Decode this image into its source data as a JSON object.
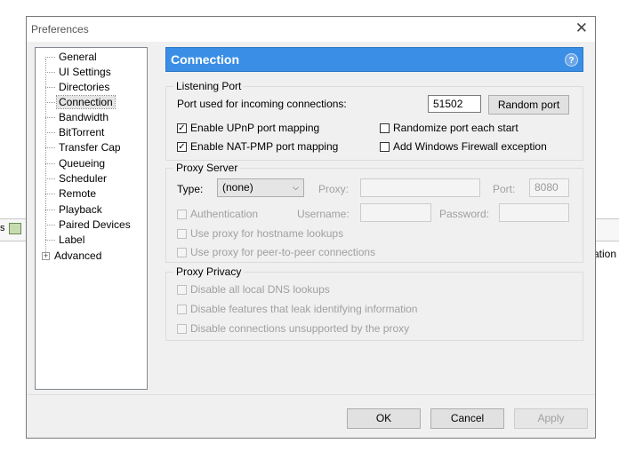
{
  "background": {
    "toolbar_text": "s",
    "right_text": "ation"
  },
  "dialog": {
    "title": "Preferences"
  },
  "tree": {
    "items": [
      {
        "label": "General"
      },
      {
        "label": "UI Settings"
      },
      {
        "label": "Directories"
      },
      {
        "label": "Connection",
        "selected": true
      },
      {
        "label": "Bandwidth"
      },
      {
        "label": "BitTorrent"
      },
      {
        "label": "Transfer Cap"
      },
      {
        "label": "Queueing"
      },
      {
        "label": "Scheduler"
      },
      {
        "label": "Remote"
      },
      {
        "label": "Playback"
      },
      {
        "label": "Paired Devices"
      },
      {
        "label": "Label"
      },
      {
        "label": "Advanced",
        "expandable": true,
        "expander": "+"
      }
    ]
  },
  "header": {
    "title": "Connection",
    "help": "?"
  },
  "listening_port": {
    "title": "Listening Port",
    "port_label": "Port used for incoming connections:",
    "port_value": "51502",
    "random_port_label": "Random port",
    "upnp_label": "Enable UPnP port mapping",
    "upnp_checked": true,
    "natpmp_label": "Enable NAT-PMP port mapping",
    "natpmp_checked": true,
    "randomize_label": "Randomize port each start",
    "randomize_checked": false,
    "firewall_label": "Add Windows Firewall exception",
    "firewall_checked": false,
    "check_mark": "✓"
  },
  "proxy_server": {
    "title": "Proxy Server",
    "type_label": "Type:",
    "type_value": "(none)",
    "proxy_label": "Proxy:",
    "proxy_value": "",
    "port_label": "Port:",
    "port_value": "8080",
    "auth_label": "Authentication",
    "username_label": "Username:",
    "username_value": "",
    "password_label": "Password:",
    "password_value": "",
    "hostname_label": "Use proxy for hostname lookups",
    "p2p_label": "Use proxy for peer-to-peer connections"
  },
  "proxy_privacy": {
    "title": "Proxy Privacy",
    "dns_label": "Disable all local DNS lookups",
    "leak_label": "Disable features that leak identifying information",
    "unsupported_label": "Disable connections unsupported by the proxy"
  },
  "buttons": {
    "ok": "OK",
    "cancel": "Cancel",
    "apply": "Apply"
  },
  "colors": {
    "header_bg": "#3a8ee6",
    "dialog_bg": "#f0f0f0"
  }
}
